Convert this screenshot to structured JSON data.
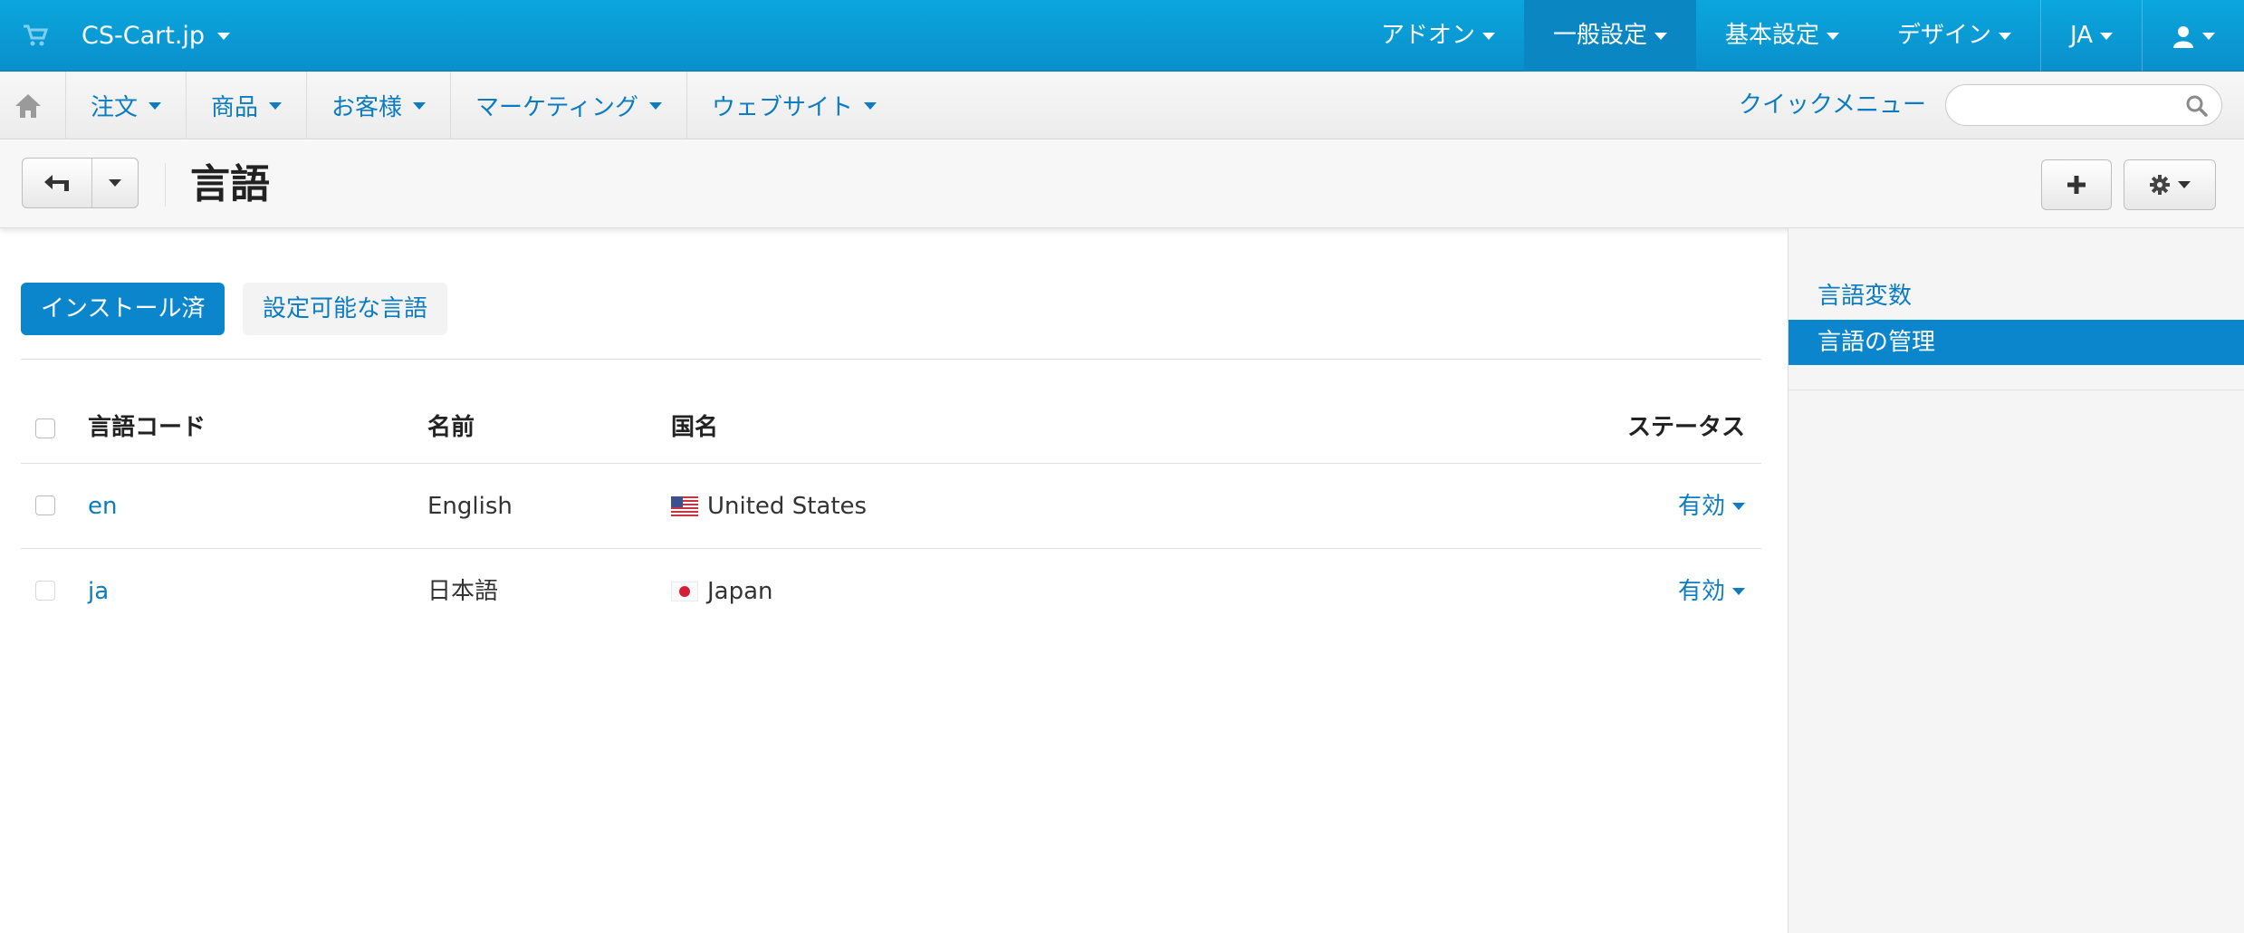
{
  "topbar": {
    "brand": "CS-Cart.jp",
    "nav": [
      {
        "label": "アドオン",
        "active": false
      },
      {
        "label": "一般設定",
        "active": true
      },
      {
        "label": "基本設定",
        "active": false
      },
      {
        "label": "デザイン",
        "active": false
      },
      {
        "label": "JA",
        "active": false
      }
    ],
    "icons": {
      "cart": "shopping-cart-icon",
      "user": "user-icon"
    }
  },
  "mainnav": {
    "items": [
      "注文",
      "商品",
      "お客様",
      "マーケティング",
      "ウェブサイト"
    ],
    "quick_menu": "クイックメニュー",
    "search_placeholder": ""
  },
  "toolbar": {
    "title": "言語"
  },
  "tabs": {
    "installed": "インストール済",
    "available": "設定可能な言語"
  },
  "table": {
    "headers": {
      "code": "言語コード",
      "name": "名前",
      "country": "国名",
      "status": "ステータス"
    },
    "rows": [
      {
        "code": "en",
        "name": "English",
        "country": "United States",
        "flag": "us-flag-icon",
        "status": "有効"
      },
      {
        "code": "ja",
        "name": "日本語",
        "country": "Japan",
        "flag": "jp-flag-icon",
        "status": "有効"
      }
    ]
  },
  "sidebar": {
    "items": [
      {
        "label": "言語変数",
        "active": false
      },
      {
        "label": "言語の管理",
        "active": true
      }
    ]
  },
  "colors": {
    "topbar": "#0a9ad5",
    "accent": "#0b86cd",
    "link": "#0b7cc1"
  }
}
